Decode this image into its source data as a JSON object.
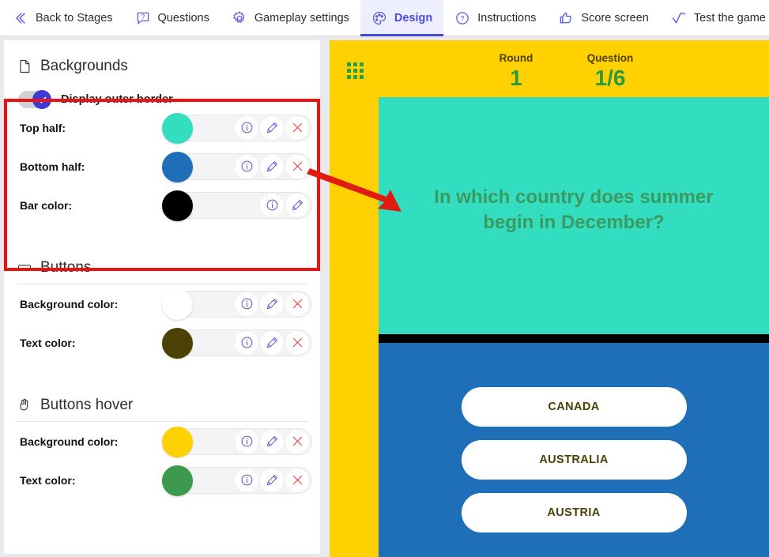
{
  "topnav": {
    "items": [
      {
        "label": "Back to Stages",
        "icon": "chevrons-left-icon",
        "active": false
      },
      {
        "label": "Questions",
        "icon": "question-bubble-icon",
        "active": false
      },
      {
        "label": "Gameplay settings",
        "icon": "gear-icon",
        "active": false
      },
      {
        "label": "Design",
        "icon": "palette-icon",
        "active": true
      },
      {
        "label": "Instructions",
        "icon": "question-circle-icon",
        "active": false
      },
      {
        "label": "Score screen",
        "icon": "thumbs-up-icon",
        "active": false
      },
      {
        "label": "Test the game",
        "icon": "check-wave-icon",
        "active": false
      }
    ],
    "accent_color": "#4a4ae0",
    "active_bg": "#eeeffc"
  },
  "sections": [
    {
      "id": "backgrounds",
      "title": "Backgrounds",
      "icon": "page-icon",
      "rule": false,
      "highlighted": true,
      "toggle": {
        "label": "Display outer border",
        "checked": true
      },
      "rows": [
        {
          "label": "Top half:",
          "color": "#33DEC0",
          "actions": [
            "info-icon",
            "pencil-icon",
            "close-icon"
          ]
        },
        {
          "label": "Bottom half:",
          "color": "#1E6EB8",
          "actions": [
            "info-icon",
            "pencil-icon",
            "close-icon"
          ]
        },
        {
          "label": "Bar color:",
          "color": "#000000",
          "actions": [
            "info-icon",
            "pencil-icon"
          ]
        }
      ]
    },
    {
      "id": "buttons",
      "title": "Buttons",
      "icon": "button-rect-icon",
      "rule": true,
      "highlighted": false,
      "rows": [
        {
          "label": "Background color:",
          "color": "#FFFFFF",
          "actions": [
            "info-icon",
            "pencil-icon",
            "close-icon"
          ]
        },
        {
          "label": "Text color:",
          "color": "#4C4105",
          "actions": [
            "info-icon",
            "pencil-icon",
            "close-icon"
          ]
        }
      ]
    },
    {
      "id": "buttons-hover",
      "title": "Buttons hover",
      "icon": "cursor-click-icon",
      "rule": true,
      "highlighted": false,
      "rows": [
        {
          "label": "Background color:",
          "color": "#FFD100",
          "actions": [
            "info-icon",
            "pencil-icon",
            "close-icon"
          ]
        },
        {
          "label": "Text color:",
          "color": "#3C9A4E",
          "actions": [
            "info-icon",
            "pencil-icon",
            "close-icon"
          ]
        }
      ]
    }
  ],
  "preview": {
    "outer_border_color": "#FFD100",
    "grid_icon": "grid-menu-icon",
    "round": {
      "label": "Round",
      "value": "1"
    },
    "question_counter": {
      "label": "Question",
      "value": "1/6"
    },
    "question_text": "In which country does summer begin in December?",
    "question_text_color": "#3A9A60",
    "top_half_color": "#33DEC0",
    "bar_color": "#000000",
    "bottom_half_color": "#1E6EB8",
    "answers": [
      "CANADA",
      "AUSTRALIA",
      "AUSTRIA"
    ],
    "answer_text_color": "#4C4105",
    "answer_bg_color": "#FFFFFF"
  },
  "annotation": {
    "box_color": "#EE1111",
    "arrow_color": "#E01B10"
  }
}
